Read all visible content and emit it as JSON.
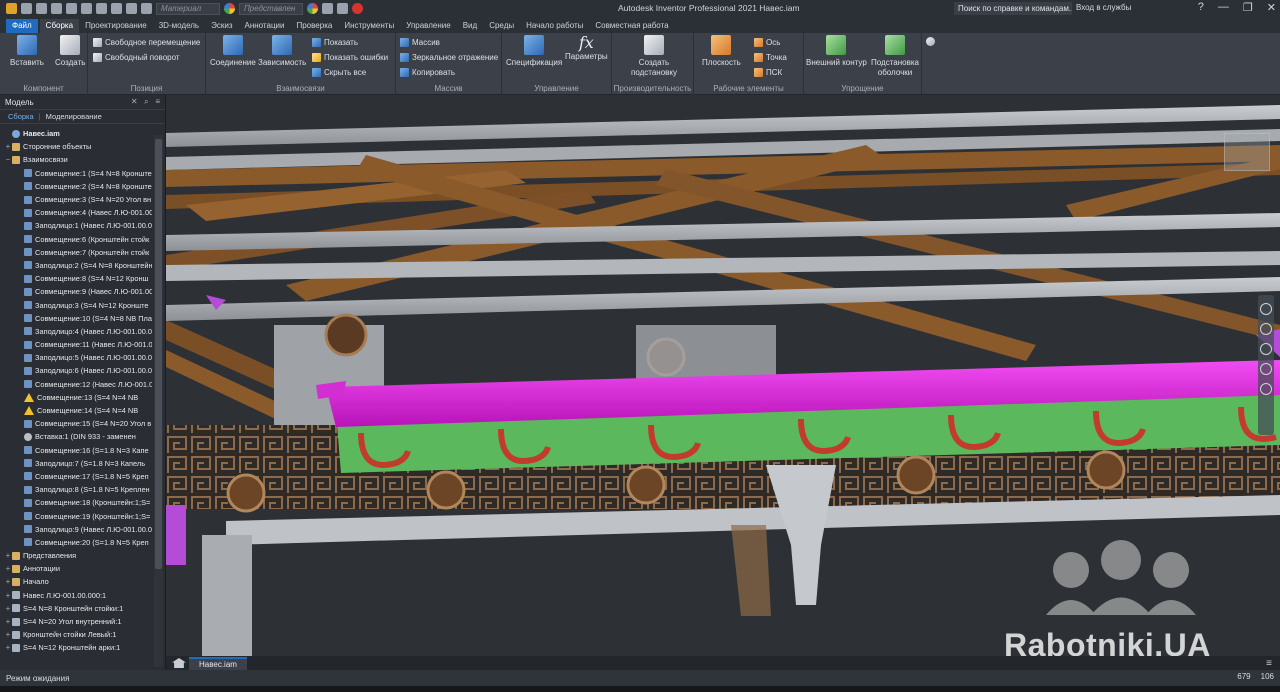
{
  "title_bar": {
    "material_placeholder": "Материал",
    "appearance_placeholder": "Представлен",
    "app_title": "Autodesk Inventor Professional 2021    Навес.iam",
    "help_search": "Поиск по справке и командам...",
    "login": "Вход в службы"
  },
  "ribbon_tabs": [
    "Файл",
    "Сборка",
    "Проектирование",
    "3D-модель",
    "Эскиз",
    "Аннотации",
    "Проверка",
    "Инструменты",
    "Управление",
    "Вид",
    "Среды",
    "Начало работы",
    "Совместная работа"
  ],
  "ribbon": {
    "component": {
      "title": "Компонент",
      "insert": "Вставить",
      "create": "Создать"
    },
    "position": {
      "title": "Позиция",
      "free_move": "Свободное перемещение",
      "free_rotate": "Свободный поворот"
    },
    "relationships": {
      "title": "Взаимосвязи",
      "joint": "Соединение",
      "constrain": "Зависимость",
      "show": "Показать",
      "show_errors": "Показать ошибки",
      "hide_all": "Скрыть все"
    },
    "pattern": {
      "title": "Массив",
      "pattern": "Массив",
      "mirror": "Зеркальное отражение",
      "copy": "Копировать"
    },
    "manage": {
      "title": "Управление",
      "bom": "Спецификация",
      "parameters": "Параметры"
    },
    "productivity": {
      "title": "Производительность",
      "create_substitute": "Создать подстановку"
    },
    "work_features": {
      "title": "Рабочие элементы",
      "plane": "Плоскость",
      "axis": "Ось",
      "point": "Точка",
      "ucs": "ПСК"
    },
    "simplification": {
      "title": "Упрощение",
      "shrinkwrap": "Внешний контур",
      "shrinkwrap_sub": "Подстановка оболочки"
    }
  },
  "browser": {
    "tab": "Модель",
    "subtab_assembly": "Сборка",
    "subtab_modeling": "Моделирование",
    "tree": [
      {
        "label": "Навес.iam",
        "icon": "assembly-icon",
        "exp": ""
      },
      {
        "label": "Сторонние объекты",
        "icon": "folder-icon",
        "exp": "+"
      },
      {
        "label": "Взаимосвязи",
        "icon": "folder-icon",
        "exp": "−"
      },
      {
        "label": "Совмещение:1 (S=4 N=8 Кронштейн",
        "icon": "constraint-icon",
        "exp": ""
      },
      {
        "label": "Совмещение:2 (S=4 N=8 Кронште",
        "icon": "constraint-icon",
        "exp": ""
      },
      {
        "label": "Совмещение:3 (S=4 N=20 Угол вн",
        "icon": "constraint-icon",
        "exp": ""
      },
      {
        "label": "Совмещение:4 (Навес Л.Ю-001.00",
        "icon": "constraint-icon",
        "exp": ""
      },
      {
        "label": "Заподлицо:1 (Навес Л.Ю-001.00.0",
        "icon": "constraint-icon",
        "exp": ""
      },
      {
        "label": "Совмещение:6 (Кронштейн стойк",
        "icon": "constraint-icon",
        "exp": ""
      },
      {
        "label": "Совмещение:7 (Кронштейн стойк",
        "icon": "constraint-icon",
        "exp": ""
      },
      {
        "label": "Заподлицо:2 (S=4 N=8 Кронштейн",
        "icon": "constraint-icon",
        "exp": ""
      },
      {
        "label": "Совмещение:8 (S=4 N=12 Кронш",
        "icon": "constraint-icon",
        "exp": ""
      },
      {
        "label": "Совмещение:9 (Навес Л.Ю-001.00",
        "icon": "constraint-icon",
        "exp": ""
      },
      {
        "label": "Заподлицо:3 (S=4 N=12 Кронште",
        "icon": "constraint-icon",
        "exp": ""
      },
      {
        "label": "Совмещение:10 (S=4 N=8 NB Пла",
        "icon": "constraint-icon",
        "exp": ""
      },
      {
        "label": "Заподлицо:4 (Навес Л.Ю-001.00.0",
        "icon": "constraint-icon",
        "exp": ""
      },
      {
        "label": "Совмещение:11 (Навес Л.Ю-001.0",
        "icon": "constraint-icon",
        "exp": ""
      },
      {
        "label": "Заподлицо:5 (Навес Л.Ю-001.00.0",
        "icon": "constraint-icon",
        "exp": ""
      },
      {
        "label": "Заподлицо:6 (Навес Л.Ю-001.00.0",
        "icon": "constraint-icon",
        "exp": ""
      },
      {
        "label": "Совмещение:12 (Навес Л.Ю-001.0",
        "icon": "constraint-icon",
        "exp": ""
      },
      {
        "label": "Совмещение:13 (S=4 N=4 NB",
        "icon": "warning-icon",
        "exp": ""
      },
      {
        "label": "Совмещение:14 (S=4 N=4 NB",
        "icon": "warning-icon",
        "exp": ""
      },
      {
        "label": "Совмещение:15 (S=4 N=20 Угол в",
        "icon": "constraint-icon",
        "exp": ""
      },
      {
        "label": "Вставка:1 (DIN 933 - заменен",
        "icon": "insert-icon",
        "exp": ""
      },
      {
        "label": "Совмещение:16 (S=1.8 N=3 Капе",
        "icon": "constraint-icon",
        "exp": ""
      },
      {
        "label": "Заподлицо:7 (S=1.8 N=3 Капель",
        "icon": "constraint-icon",
        "exp": ""
      },
      {
        "label": "Совмещение:17 (S=1.8 N=5 Креп",
        "icon": "constraint-icon",
        "exp": ""
      },
      {
        "label": "Заподлицо:8 (S=1.8 N=5 Креплен",
        "icon": "constraint-icon",
        "exp": ""
      },
      {
        "label": "Совмещение:18 (Кронштейн:1;S=",
        "icon": "constraint-icon",
        "exp": ""
      },
      {
        "label": "Совмещение:19 (Кронштейн:1;S=",
        "icon": "constraint-icon",
        "exp": ""
      },
      {
        "label": "Заподлицо:9 (Навес Л.Ю-001.00.0",
        "icon": "constraint-icon",
        "exp": ""
      },
      {
        "label": "Совмещение:20 (S=1.8 N=5 Креп",
        "icon": "constraint-icon",
        "exp": ""
      },
      {
        "label": "Представления",
        "icon": "folder-icon",
        "exp": "+"
      },
      {
        "label": "Аннотации",
        "icon": "folder-icon",
        "exp": "+"
      },
      {
        "label": "Начало",
        "icon": "folder-icon",
        "exp": "+"
      },
      {
        "label": "Навес Л.Ю-001.00.000:1",
        "icon": "part-icon",
        "exp": "+"
      },
      {
        "label": "S=4 N=8 Кронштейн стойки:1",
        "icon": "part-icon",
        "exp": "+"
      },
      {
        "label": "S=4 N=20 Угол внутренний:1",
        "icon": "part-icon",
        "exp": "+"
      },
      {
        "label": "Кронштейн стойки Левый:1",
        "icon": "part-icon",
        "exp": "+"
      },
      {
        "label": "S=4 N=12 Кронштейн арки:1",
        "icon": "part-icon",
        "exp": "+"
      }
    ]
  },
  "document_tab": "Навес.iam",
  "status": {
    "text": "Режим ожидания",
    "num1": "679",
    "num2": "106"
  },
  "watermark": "Rabotniki.UA",
  "colors": {
    "accent": "#1e6bbf",
    "magenta_gutter": "#e61ee6",
    "green_panel": "#5cb85c",
    "wood": "#8a5a2b"
  }
}
